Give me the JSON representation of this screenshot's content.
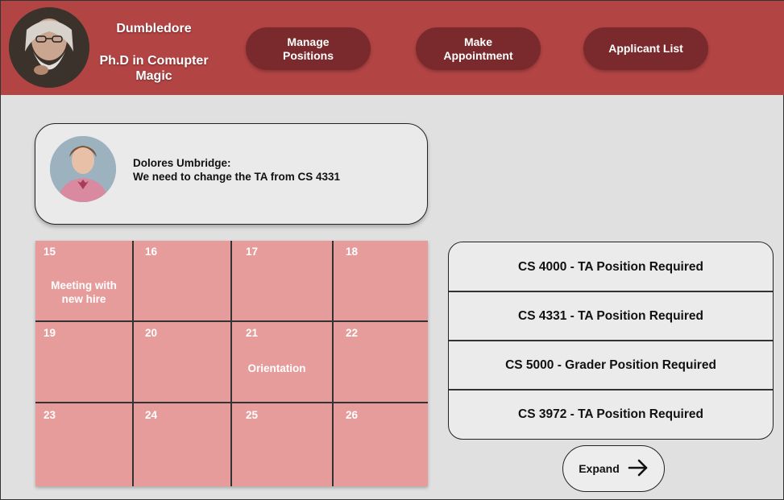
{
  "profile": {
    "name": "Dumbledore",
    "title_line1": "Ph.D in Comupter",
    "title_line2": "Magic"
  },
  "nav": [
    {
      "line1": "Manage",
      "line2": "Positions"
    },
    {
      "line1": "Make",
      "line2": "Appointment"
    },
    {
      "line1": "Applicant List",
      "line2": ""
    }
  ],
  "message": {
    "sender": "Dolores Umbridge:",
    "text": "We need to change the TA from CS 4331"
  },
  "calendar": {
    "days": [
      "15",
      "16",
      "17",
      "18",
      "19",
      "20",
      "21",
      "22",
      "23",
      "24",
      "25",
      "26"
    ],
    "events": [
      {
        "line1": "Meeting with",
        "line2": "new hire"
      },
      {
        "line1": "Orientation",
        "line2": ""
      }
    ]
  },
  "positions": [
    "CS 4000 - TA Position Required",
    "CS 4331 - TA Position Required",
    "CS 5000 - Grader Position Required",
    "CS 3972 - TA Position Required"
  ],
  "expand_label": "Expand",
  "icons": {
    "expand": "arrow-right-icon"
  },
  "colors": {
    "header": "#b34444",
    "nav_button": "#7a2a2c",
    "calendar": "#e79c9c",
    "background": "#e0e0e0"
  }
}
